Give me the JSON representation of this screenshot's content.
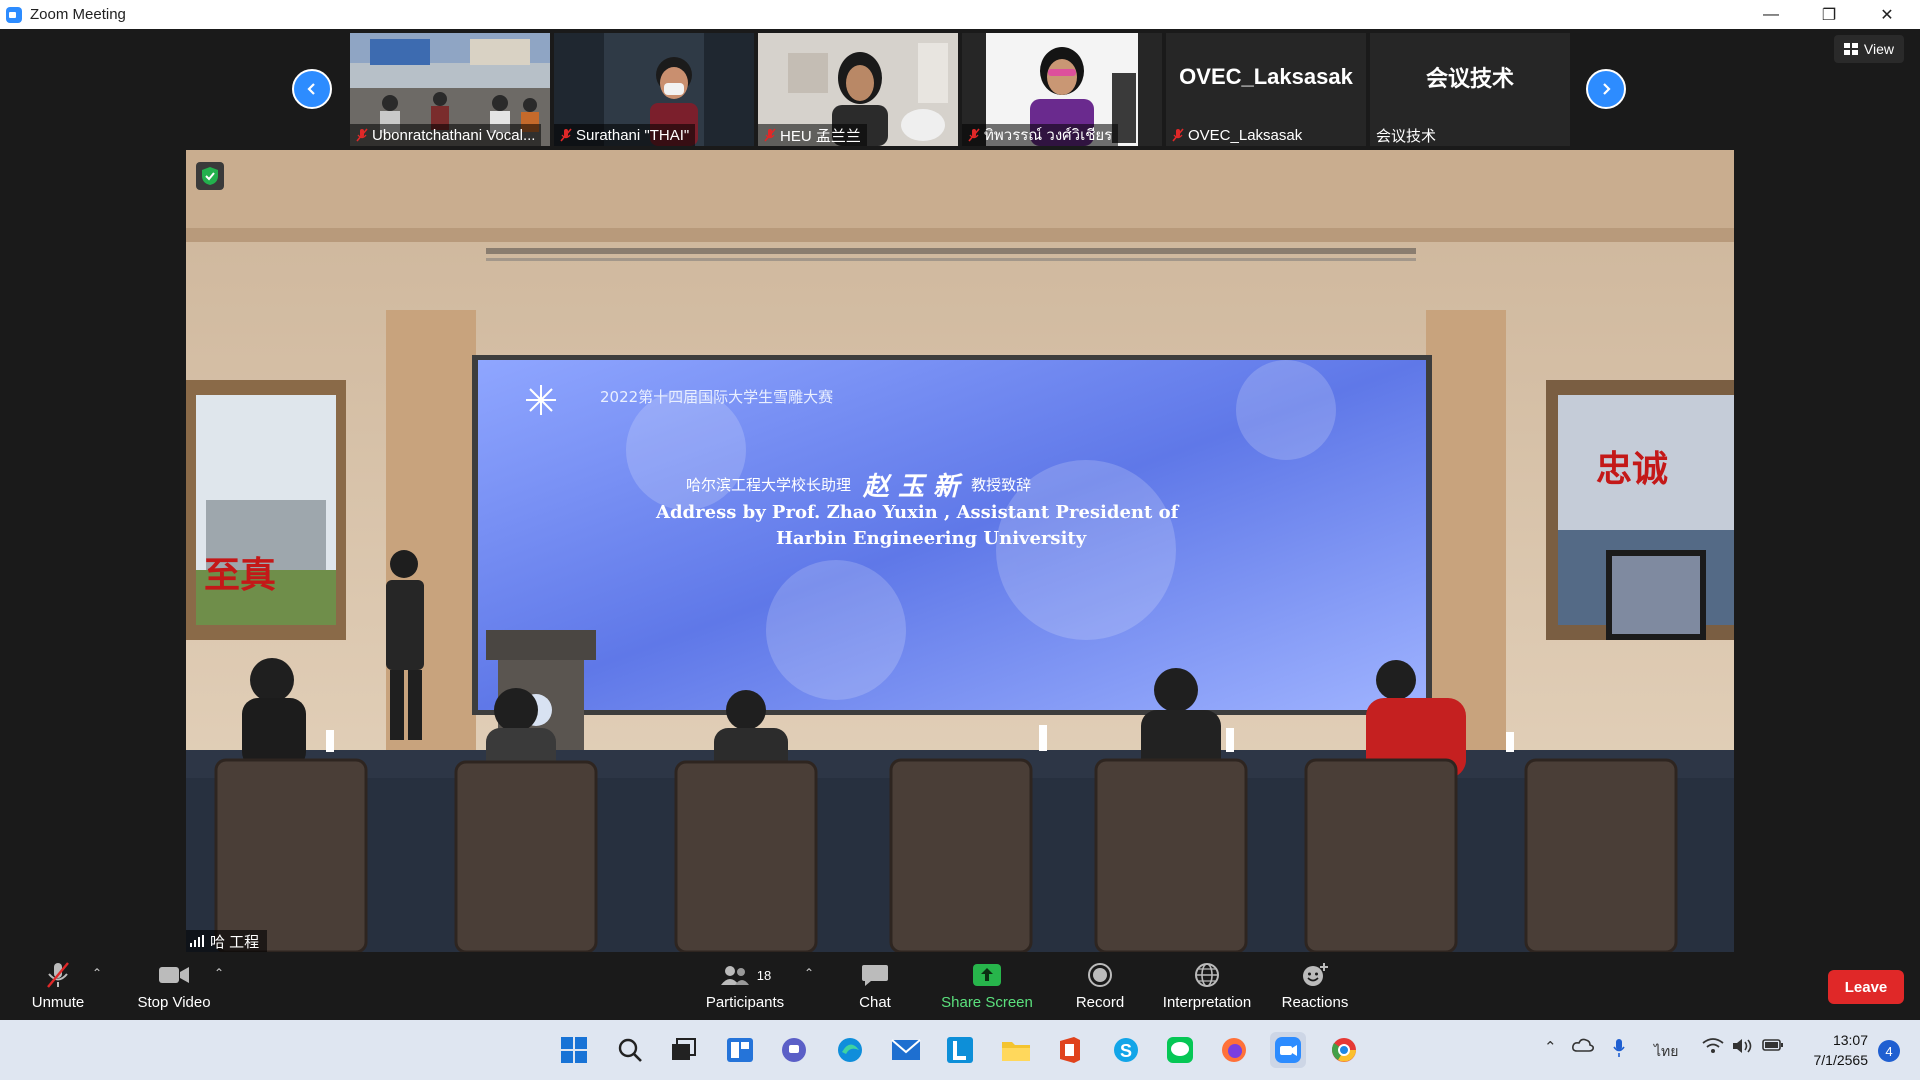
{
  "window": {
    "title": "Zoom Meeting"
  },
  "view_button": {
    "label": "View"
  },
  "participants_strip": [
    {
      "name": "Ubonratchathani Vocal...",
      "kind": "video"
    },
    {
      "name": "Surathani \"THAI\"",
      "kind": "video"
    },
    {
      "name": "HEU 孟兰兰",
      "kind": "video"
    },
    {
      "name": "ทิพวรรณ์ วงศ์วิเชียร",
      "kind": "video"
    },
    {
      "name": "OVEC_Laksasak",
      "kind": "name",
      "display": "OVEC_Laksasak"
    },
    {
      "name": "会议技术",
      "kind": "name",
      "display": "会议技术"
    }
  ],
  "main_video": {
    "speaker_label": "哈 工程",
    "screen_line1": "2022第十四届国际大学生雪雕大赛",
    "screen_line2_prefix": "哈尔滨工程大学校长助理",
    "screen_line2_name": "赵 玉 新",
    "screen_line2_suffix": "教授致辞",
    "screen_line3": "Address by Prof. Zhao Yuxin , Assistant President of",
    "screen_line4": "Harbin Engineering University",
    "wall_sign_left": "至真",
    "wall_sign_right": "忠诚"
  },
  "toolbar": {
    "unmute": "Unmute",
    "stop_video": "Stop Video",
    "participants": "Participants",
    "participants_count": "18",
    "chat": "Chat",
    "share_screen": "Share Screen",
    "record": "Record",
    "interpretation": "Interpretation",
    "reactions": "Reactions",
    "leave": "Leave"
  },
  "taskbar": {
    "language": "ไทย",
    "time": "13:07",
    "date": "7/1/2565",
    "notifications": "4"
  },
  "colors": {
    "zoom_blue": "#2d8cff",
    "leave_red": "#e02828",
    "share_green": "#27b54b"
  }
}
